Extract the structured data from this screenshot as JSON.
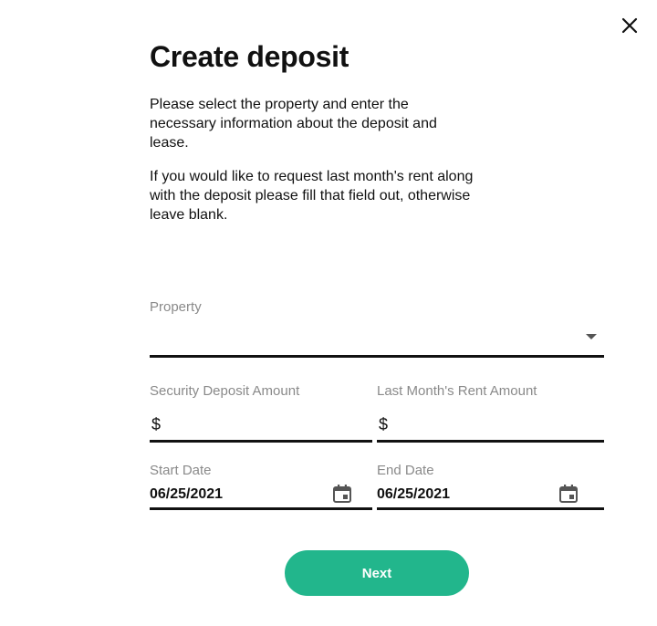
{
  "dialog": {
    "title": "Create deposit",
    "description_1": "Please select the property and enter the necessary information about the deposit and lease.",
    "description_2": "If you would like to request last month's rent along with the deposit please fill that field out, otherwise leave blank.",
    "close_icon": "close-icon"
  },
  "form": {
    "property": {
      "label": "Property",
      "value": "",
      "icon": "dropdown-arrow-icon"
    },
    "security_deposit": {
      "label": "Security Deposit Amount",
      "prefix": "$",
      "value": ""
    },
    "last_month_rent": {
      "label": "Last Month's Rent Amount",
      "prefix": "$",
      "value": ""
    },
    "start_date": {
      "label": "Start Date",
      "value": "06/25/2021",
      "icon": "calendar-icon"
    },
    "end_date": {
      "label": "End Date",
      "value": "06/25/2021",
      "icon": "calendar-icon"
    }
  },
  "actions": {
    "next_label": "Next"
  },
  "colors": {
    "accent": "#22b68c",
    "text": "#111111",
    "label": "#8a8a8a"
  }
}
